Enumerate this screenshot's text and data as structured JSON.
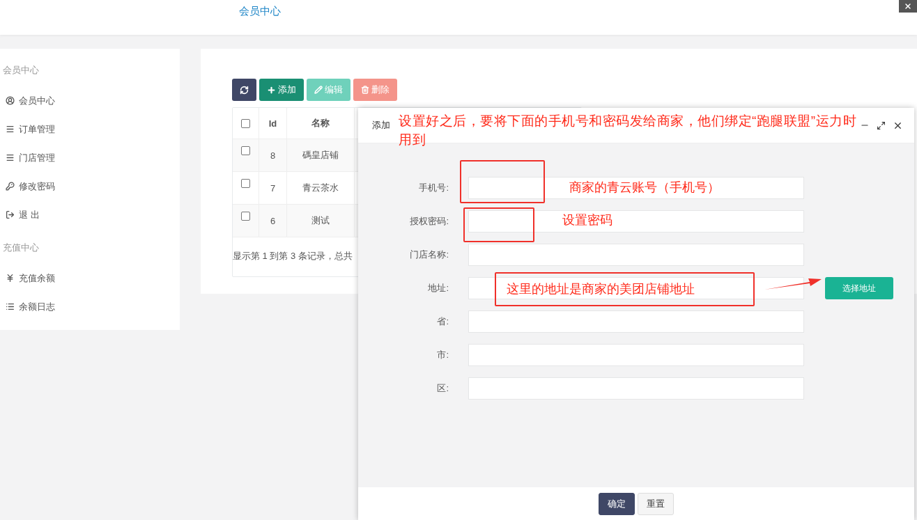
{
  "header": {
    "title": "会员中心"
  },
  "sidebar": {
    "sections": [
      {
        "title": "会员中心",
        "items": [
          {
            "kind": "user",
            "label": "会员中心"
          },
          {
            "kind": "menu",
            "label": "订单管理"
          },
          {
            "kind": "menu",
            "label": "门店管理"
          },
          {
            "kind": "key",
            "label": "修改密码"
          },
          {
            "kind": "logout",
            "label": "退 出"
          }
        ]
      },
      {
        "title": "充值中心",
        "items": [
          {
            "kind": "yen",
            "label": "充值余额"
          },
          {
            "kind": "list",
            "label": "余额日志"
          }
        ]
      }
    ]
  },
  "toolbar": [
    {
      "kind": "refresh",
      "disabled": false
    },
    {
      "kind": "add",
      "label": "添加",
      "disabled": false
    },
    {
      "kind": "edit",
      "label": "编辑",
      "disabled": true
    },
    {
      "kind": "delete",
      "label": "删除",
      "disabled": true
    }
  ],
  "table": {
    "header_checked": false,
    "columns": [
      "Id",
      "名称"
    ],
    "rows": [
      {
        "checked": false,
        "cells": [
          "8",
          "碼皇店铺"
        ]
      },
      {
        "checked": false,
        "cells": [
          "7",
          "青云茶水"
        ]
      },
      {
        "checked": false,
        "cells": [
          "6",
          "测试"
        ]
      }
    ],
    "footer": "显示第 1 到第 3 条记录，总共"
  },
  "dialog": {
    "title": "添加",
    "fields": [
      {
        "label": "手机号:"
      },
      {
        "label": "授权密码:"
      },
      {
        "label": "门店名称:"
      },
      {
        "label": "地址:",
        "button": "选择地址"
      },
      {
        "label": "省:"
      },
      {
        "label": "市:"
      },
      {
        "label": "区:"
      }
    ],
    "buttons": [
      {
        "kind": "primary",
        "label": "确定"
      },
      {
        "kind": "default",
        "label": "重置"
      }
    ]
  },
  "annotations": {
    "note": "设置好之后，要将下面的手机号和密码发给商家，他们绑定“跑腿联盟”运力时用到",
    "labels": [
      "商家的青云账号（手机号）",
      "设置密码",
      "这里的地址是商家的美团店铺地址"
    ]
  }
}
